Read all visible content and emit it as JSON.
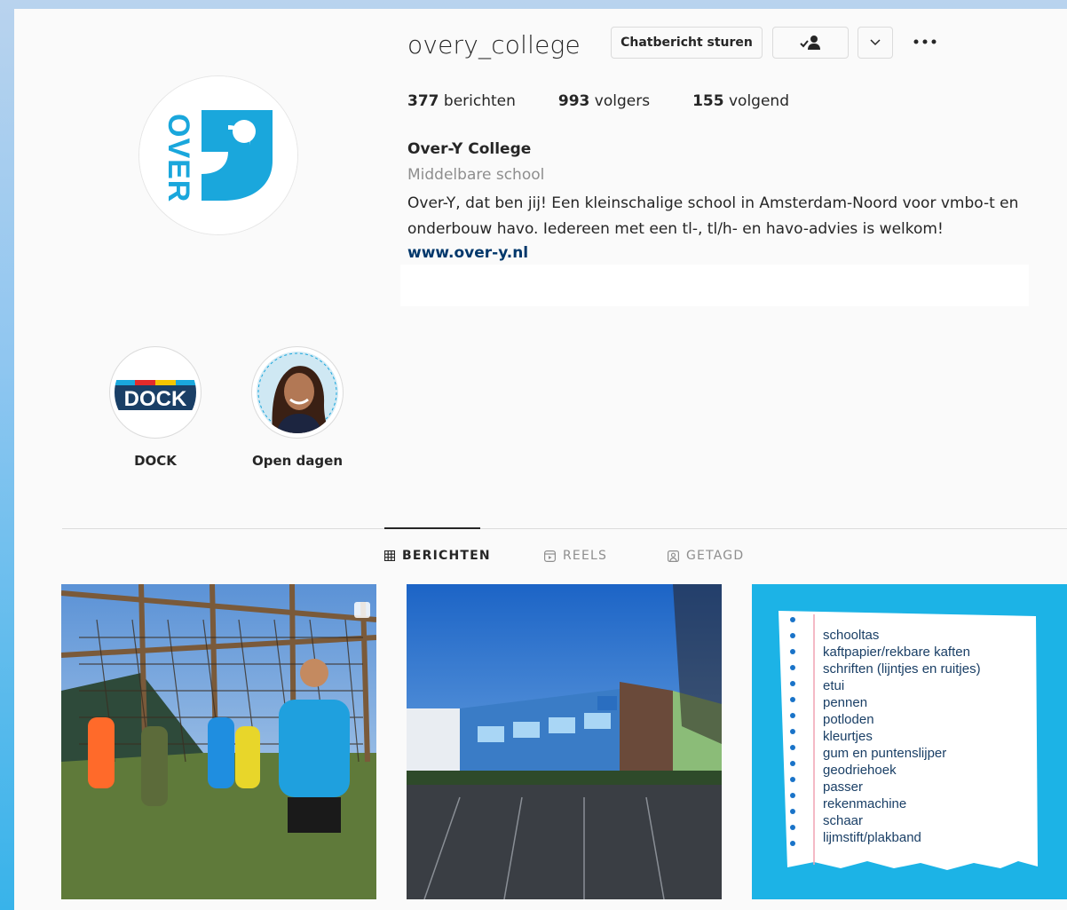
{
  "profile": {
    "username": "overy_college",
    "avatar_text": "OVER",
    "full_name": "Over-Y College",
    "category": "Middelbare school",
    "bio": "Over-Y, dat ben jij! Een kleinschalige school in Amsterdam-Noord voor vmbo-t en onderbouw havo. Iedereen met een tl-, tl/h- en havo-advies is welkom!",
    "website": "www.over-y.nl",
    "brand_color": "#1aa7dc"
  },
  "actions": {
    "message_label": "Chatbericht sturen",
    "follow_icon": "person-check-icon",
    "dropdown_icon": "chevron-down-icon",
    "more_icon": "more-horizontal-icon"
  },
  "stats": [
    {
      "count": "377",
      "label": "berichten"
    },
    {
      "count": "993",
      "label": "volgers"
    },
    {
      "count": "155",
      "label": "volgend"
    }
  ],
  "highlights": [
    {
      "label": "DOCK",
      "cover_text": "DOCK"
    },
    {
      "label": "Open dagen"
    }
  ],
  "tabs": [
    {
      "label": "BERICHTEN",
      "icon": "grid-icon",
      "active": true
    },
    {
      "label": "REELS",
      "icon": "reels-icon",
      "active": false
    },
    {
      "label": "GETAGD",
      "icon": "tagged-icon",
      "active": false
    }
  ],
  "posts": [
    {
      "type": "photo",
      "subject": "students-climbing-net"
    },
    {
      "type": "photo",
      "subject": "school-building"
    },
    {
      "type": "list",
      "items": [
        "schooltas",
        "kaftpapier/rekbare kaften",
        "schriften (lijntjes en ruitjes)",
        "etui",
        "pennen",
        "potloden",
        "kleurtjes",
        "gum en puntenslijper",
        "geodriehoek",
        "passer",
        "rekenmachine",
        "schaar",
        "lijmstift/plakband"
      ]
    }
  ]
}
